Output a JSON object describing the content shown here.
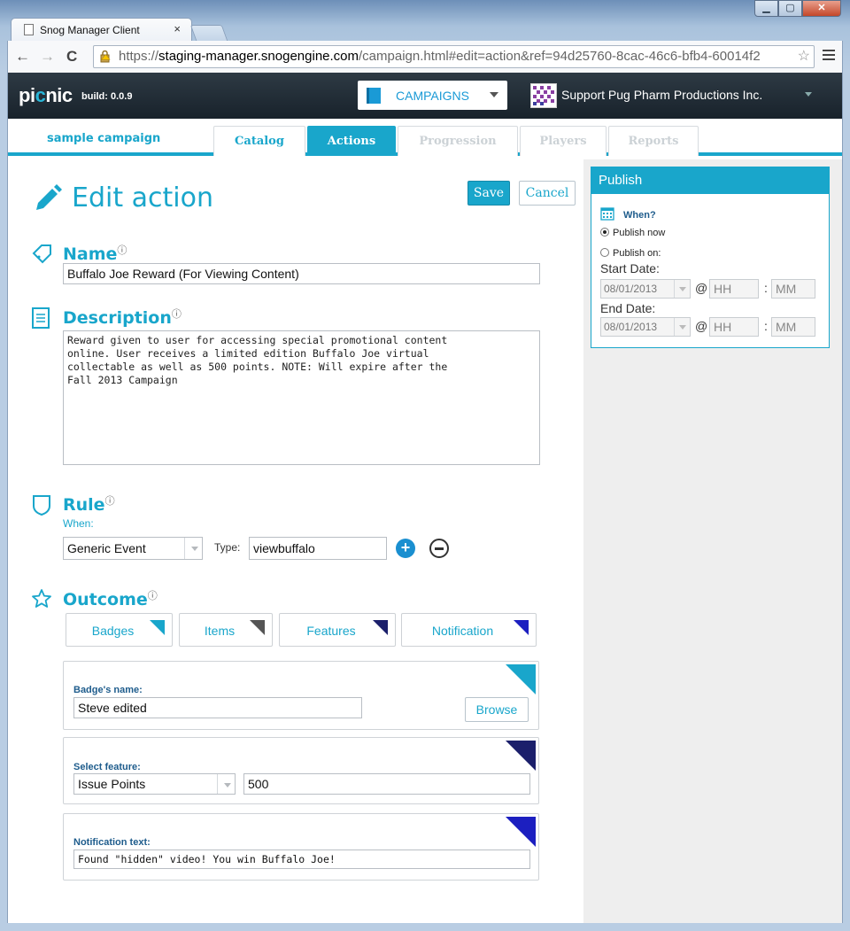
{
  "browser": {
    "tab_title": "Snog Manager Client",
    "tab_close": "×",
    "url_scheme": "https://",
    "url_host": "staging-manager.snogengine.com",
    "url_rest": "/campaign.html#edit=action&ref=94d25760-8cac-46c6-bfb4-60014f2",
    "back": "←",
    "forward": "→",
    "reload": "C",
    "star": "☆"
  },
  "appbar": {
    "logo_main": "pi",
    "logo_c": "c",
    "logo_end": "nic",
    "build": "build: 0.0.9",
    "section": "CAMPAIGNS",
    "org": "Support Pug Pharm Productions Inc."
  },
  "subnav": {
    "campaign_name": "sample campaign",
    "tabs": [
      {
        "label": "Catalog",
        "state": "normal"
      },
      {
        "label": "Actions",
        "state": "active"
      },
      {
        "label": "Progression",
        "state": "disabled"
      },
      {
        "label": "Players",
        "state": "disabled"
      },
      {
        "label": "Reports",
        "state": "disabled"
      }
    ]
  },
  "editor": {
    "title": "Edit action",
    "save": "Save",
    "cancel": "Cancel",
    "info_mark": "ⓘ",
    "name": {
      "label": "Name",
      "value": "Buffalo Joe Reward (For Viewing Content)"
    },
    "description": {
      "label": "Description",
      "value": "Reward given to user for accessing special promotional content\nonline. User receives a limited edition Buffalo Joe virtual\ncollectable as well as 500 points. NOTE: Will expire after the\nFall 2013 Campaign"
    },
    "rule": {
      "label": "Rule",
      "when_label": "When:",
      "event": "Generic Event",
      "type_label": "Type:",
      "type_value": "viewbuffalo",
      "add": "+"
    },
    "outcome": {
      "label": "Outcome",
      "tabs": [
        "Badges",
        "Items",
        "Features",
        "Notification"
      ],
      "badge_label": "Badge's name:",
      "badge_value": "Steve edited",
      "browse": "Browse",
      "feature_label": "Select feature:",
      "feature_value": "Issue Points",
      "feature_amount": "500",
      "notification_label": "Notification text:",
      "notification_value": "Found \"hidden\" video! You win Buffalo Joe!"
    }
  },
  "publish": {
    "title": "Publish",
    "when": "When?",
    "now": "Publish now",
    "on": "Publish on:",
    "start_label": "Start Date:",
    "start_date": "08/01/2013",
    "end_label": "End Date:",
    "end_date": "08/01/2013",
    "at": "@",
    "hh": "HH",
    "mm": "MM",
    "colon": ":"
  },
  "colors": {
    "accent": "#19a6cb",
    "appbar": "#1f2a33",
    "label_dark": "#1e5c8c"
  }
}
